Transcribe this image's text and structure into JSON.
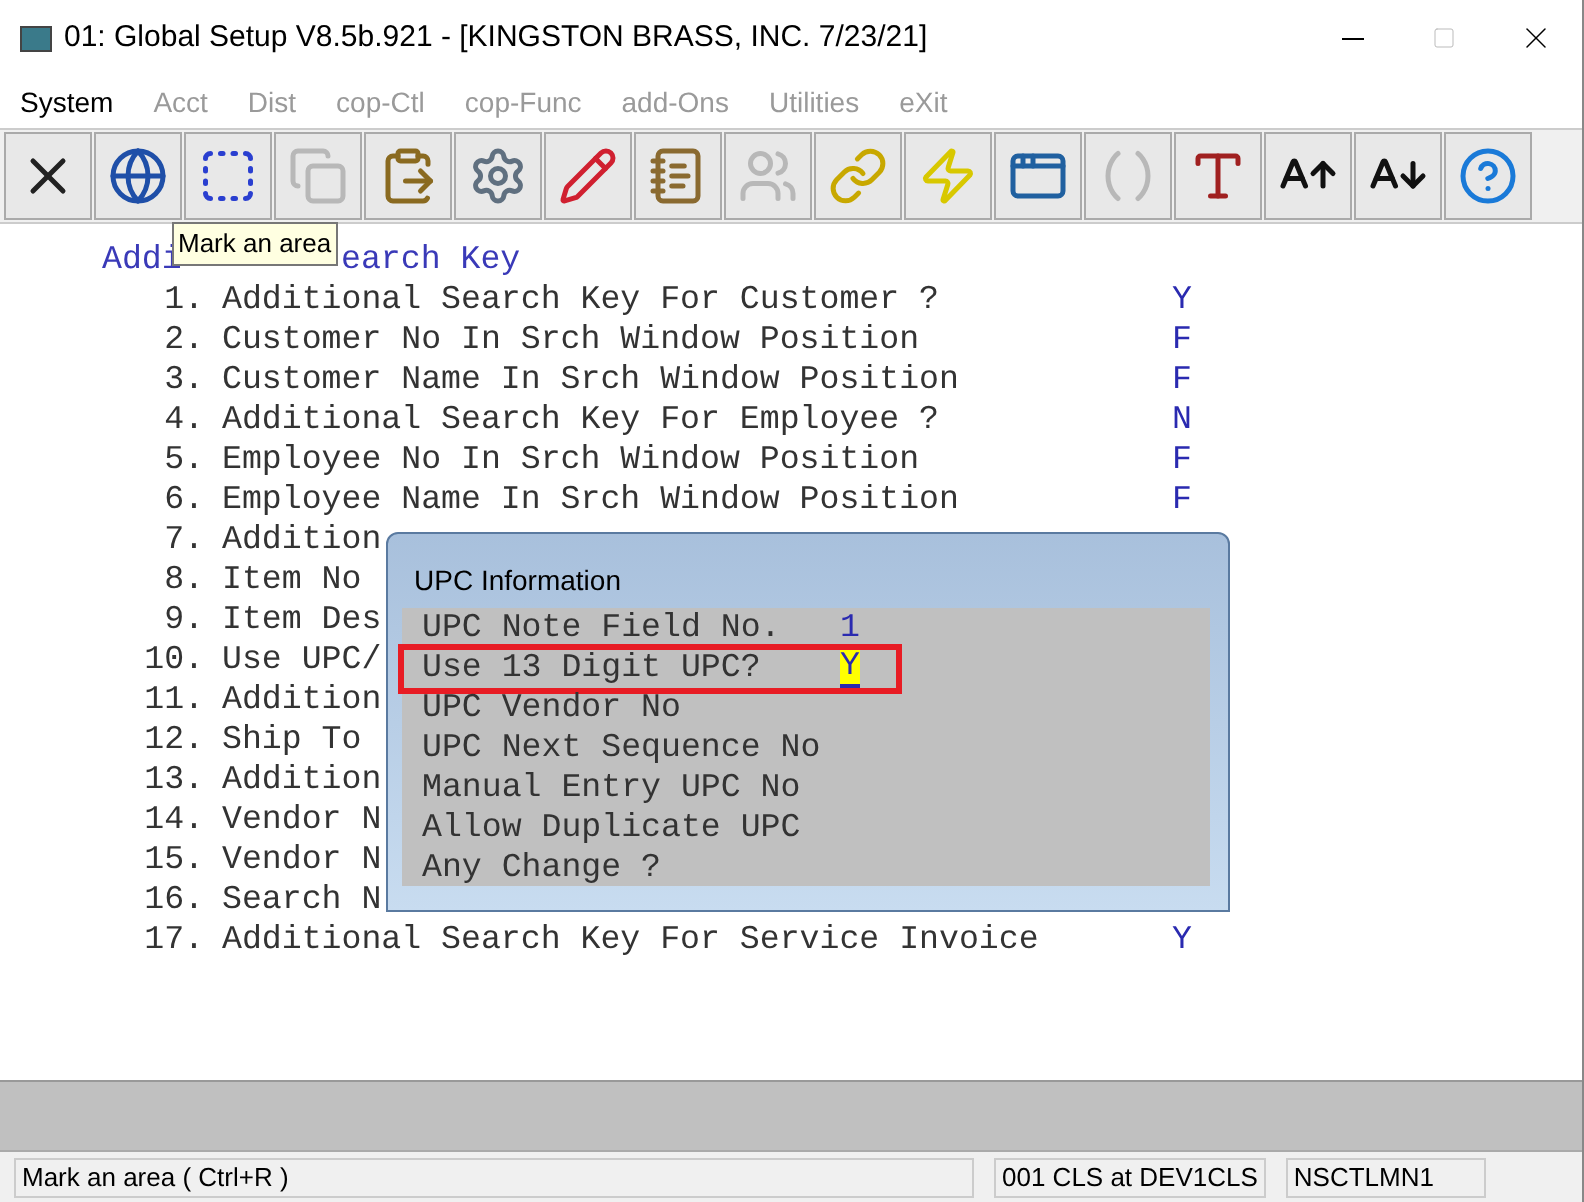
{
  "window": {
    "title": "01: Global Setup V8.5b.921 - [KINGSTON BRASS, INC. 7/23/21]"
  },
  "menu": [
    {
      "label": "System",
      "disabled": false
    },
    {
      "label": "Acct",
      "disabled": true
    },
    {
      "label": "Dist",
      "disabled": true
    },
    {
      "label": "cop-Ctl",
      "disabled": true
    },
    {
      "label": "cop-Func",
      "disabled": true
    },
    {
      "label": "add-Ons",
      "disabled": true
    },
    {
      "label": "Utilities",
      "disabled": true
    },
    {
      "label": "eXit",
      "disabled": true
    }
  ],
  "toolbar": [
    {
      "kind": "close",
      "disabled": false
    },
    {
      "kind": "globe",
      "disabled": false
    },
    {
      "kind": "mark",
      "disabled": false
    },
    {
      "kind": "copy",
      "disabled": true
    },
    {
      "kind": "paste",
      "disabled": false
    },
    {
      "kind": "settings",
      "disabled": false
    },
    {
      "kind": "edit",
      "disabled": false
    },
    {
      "kind": "notes",
      "disabled": false
    },
    {
      "kind": "users",
      "disabled": true
    },
    {
      "kind": "link",
      "disabled": false
    },
    {
      "kind": "bolt",
      "disabled": false
    },
    {
      "kind": "window-bolt",
      "disabled": false
    },
    {
      "kind": "function",
      "disabled": true
    },
    {
      "kind": "font",
      "disabled": false
    },
    {
      "kind": "font-up",
      "disabled": false
    },
    {
      "kind": "font-down",
      "disabled": false
    },
    {
      "kind": "help",
      "disabled": false
    }
  ],
  "tooltip": "Mark an area",
  "heading_parts": [
    "Addi",
    "earch Key"
  ],
  "settings": [
    {
      "number": "1.",
      "label": "Additional Search Key For Customer ?",
      "value": "Y"
    },
    {
      "number": "2.",
      "label": "Customer No In Srch Window Position",
      "value": "F"
    },
    {
      "number": "3.",
      "label": "Customer Name In Srch Window Position",
      "value": "F"
    },
    {
      "number": "4.",
      "label": "Additional Search Key For Employee ?",
      "value": "N"
    },
    {
      "number": "5.",
      "label": "Employee No In Srch Window Position",
      "value": "F"
    },
    {
      "number": "6.",
      "label": "Employee Name In Srch Window Position",
      "value": "F"
    },
    {
      "number": "7.",
      "label": "Addition"
    },
    {
      "number": "8.",
      "label": "Item No"
    },
    {
      "number": "9.",
      "label": "Item Des"
    },
    {
      "number": "10.",
      "label": "Use UPC/"
    },
    {
      "number": "11.",
      "label": "Addition"
    },
    {
      "number": "12.",
      "label": "Ship To"
    },
    {
      "number": "13.",
      "label": "Addition"
    },
    {
      "number": "14.",
      "label": "Vendor N"
    },
    {
      "number": "15.",
      "label": "Vendor N"
    },
    {
      "number": "16.",
      "label": "Search N"
    },
    {
      "number": "17.",
      "label": "Additional Search Key For Service Invoice",
      "value": "Y"
    }
  ],
  "dialog": {
    "title": "UPC Information",
    "fields": [
      {
        "label": "UPC Note Field No.",
        "value": "1",
        "focused": false
      },
      {
        "label": "Use 13 Digit UPC?",
        "value": "Y",
        "focused": true
      },
      {
        "label": "UPC Vendor No",
        "focused": false
      },
      {
        "label": "UPC Next Sequence No",
        "focused": false
      },
      {
        "label": "Manual Entry UPC No",
        "focused": false
      },
      {
        "label": "Allow Duplicate UPC",
        "focused": false
      },
      {
        "label": "Any Change ?",
        "focused": false
      }
    ]
  },
  "status_bar": [
    "Mark an area ( Ctrl+R )",
    "001 CLS at DEV1CLS",
    "NSCTLMN1"
  ]
}
